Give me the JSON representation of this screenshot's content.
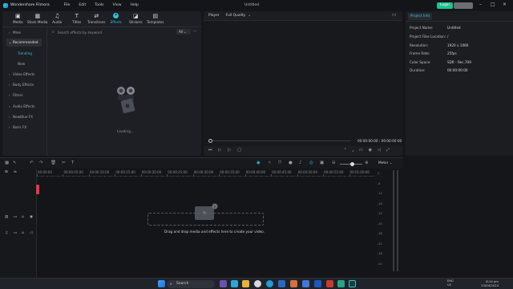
{
  "titlebar": {
    "app_name": "Wondershare Filmora",
    "menu": [
      "File",
      "Edit",
      "Tools",
      "View",
      "Help"
    ],
    "project_title": "Untitled",
    "login_label": "Login"
  },
  "toolbar": {
    "tabs": [
      {
        "label": "Media",
        "icon": "media-icon"
      },
      {
        "label": "Stock Media",
        "icon": "stock-media-icon"
      },
      {
        "label": "Audio",
        "icon": "audio-icon"
      },
      {
        "label": "Titles",
        "icon": "titles-icon"
      },
      {
        "label": "Transitions",
        "icon": "transitions-icon"
      },
      {
        "label": "Effects",
        "icon": "effects-icon",
        "active": true
      },
      {
        "label": "Stickers",
        "icon": "stickers-icon"
      },
      {
        "label": "Templates",
        "icon": "templates-icon"
      }
    ]
  },
  "effects": {
    "sidebar": {
      "mine": "Mine",
      "recommended": "Recommended",
      "trending": "Trending",
      "new": "New",
      "video": "Video Effects",
      "body": "Body Effects",
      "filters": "Filters",
      "audio": "Audio Effects",
      "newblue": "NewBlue FX",
      "boris": "Boris FX"
    },
    "search_placeholder": "Search effects by keyword",
    "filter_value": "All",
    "loading_text": "Loading..."
  },
  "player": {
    "tab_label": "Player",
    "quality": "Full Quality",
    "current_time": "00:00:00:00",
    "total_time": "00:00:00:00"
  },
  "project_info": {
    "tab_label": "Project Info",
    "rows": [
      {
        "label": "Project Name:",
        "value": "Untitled"
      },
      {
        "label": "Project Files Location:",
        "value": "/"
      },
      {
        "label": "Resolution:",
        "value": "1920 x 1080"
      },
      {
        "label": "Frame Rate:",
        "value": "25fps"
      },
      {
        "label": "Color Space:",
        "value": "SDR - Rec.709"
      },
      {
        "label": "Duration:",
        "value": "00:00:00:00"
      }
    ]
  },
  "timeline": {
    "meter_label": "Meter",
    "ruler": [
      "00:00:00",
      "00:00:05:00",
      "00:00:10:00",
      "00:00:15:00",
      "00:00:20:00",
      "00:00:25:00",
      "00:00:30:00",
      "00:00:35:00",
      "00:00:40:00",
      "00:00:45:00",
      "00:00:50:00",
      "00:00:55:00",
      "00:01:00:00"
    ],
    "drop_text": "Drag and drop media and effects here to create your video.",
    "meter_scale": [
      "0",
      "-6",
      "-12",
      "-18",
      "-24",
      "-30",
      "-36",
      "-42",
      "-48",
      "-54"
    ]
  },
  "taskbar": {
    "search_placeholder": "Search",
    "lang": "ENG",
    "region": "US",
    "time": "8:14 am",
    "date": "23/04/2024"
  },
  "colors": {
    "accent": "#2ec4d8",
    "login": "#1ec28f",
    "playhead": "#e2374a"
  }
}
